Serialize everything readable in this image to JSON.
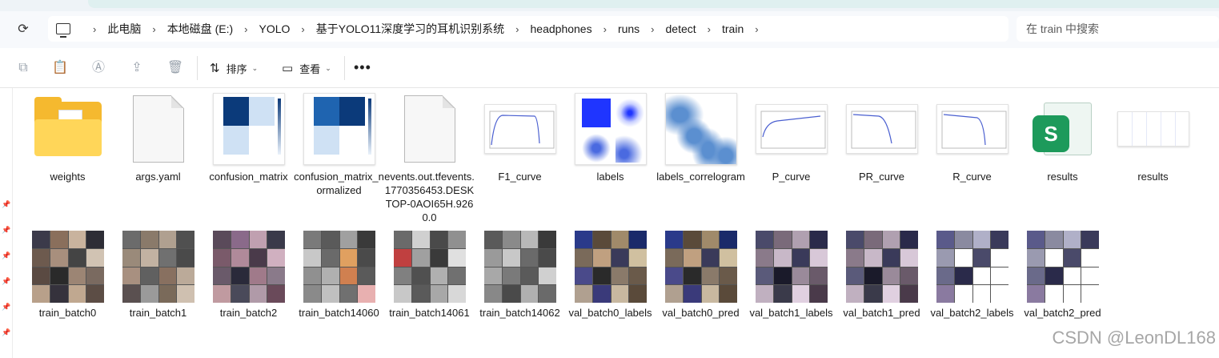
{
  "address_bar": {
    "breadcrumbs": [
      "此电脑",
      "本地磁盘 (E:)",
      "YOLO",
      "基于YOLO11深度学习的耳机识别系统",
      "headphones",
      "runs",
      "detect",
      "train"
    ],
    "search_placeholder": "在 train 中搜索"
  },
  "toolbar": {
    "sort_label": "排序",
    "view_label": "查看"
  },
  "row1": [
    {
      "name": "weights",
      "kind": "folder"
    },
    {
      "name": "args.yaml",
      "kind": "file"
    },
    {
      "name": "confusion_matrix",
      "kind": "matrix"
    },
    {
      "name": "confusion_matrix_normalized",
      "kind": "matrix"
    },
    {
      "name": "events.out.tfevents.1770356453.DESKTOP-0AOI65H.9260.0",
      "kind": "file"
    },
    {
      "name": "F1_curve",
      "kind": "plot"
    },
    {
      "name": "labels",
      "kind": "labels"
    },
    {
      "name": "labels_correlogram",
      "kind": "correlogram"
    },
    {
      "name": "P_curve",
      "kind": "plot"
    },
    {
      "name": "PR_curve",
      "kind": "plot"
    },
    {
      "name": "R_curve",
      "kind": "plot"
    },
    {
      "name": "results",
      "kind": "xlsx"
    },
    {
      "name": "results",
      "kind": "resultsplot"
    }
  ],
  "row2": [
    {
      "name": "train_batch0"
    },
    {
      "name": "train_batch1"
    },
    {
      "name": "train_batch2"
    },
    {
      "name": "train_batch14060"
    },
    {
      "name": "train_batch14061"
    },
    {
      "name": "train_batch14062"
    },
    {
      "name": "val_batch0_labels"
    },
    {
      "name": "val_batch0_pred"
    },
    {
      "name": "val_batch1_labels"
    },
    {
      "name": "val_batch1_pred"
    },
    {
      "name": "val_batch2_labels"
    },
    {
      "name": "val_batch2_pred"
    }
  ],
  "watermark": "CSDN @LeonDL168",
  "colors": {
    "accent_blue": "#2a4fd8",
    "folder_yellow": "#f5b92f",
    "excel_green": "#1d9a5b"
  }
}
